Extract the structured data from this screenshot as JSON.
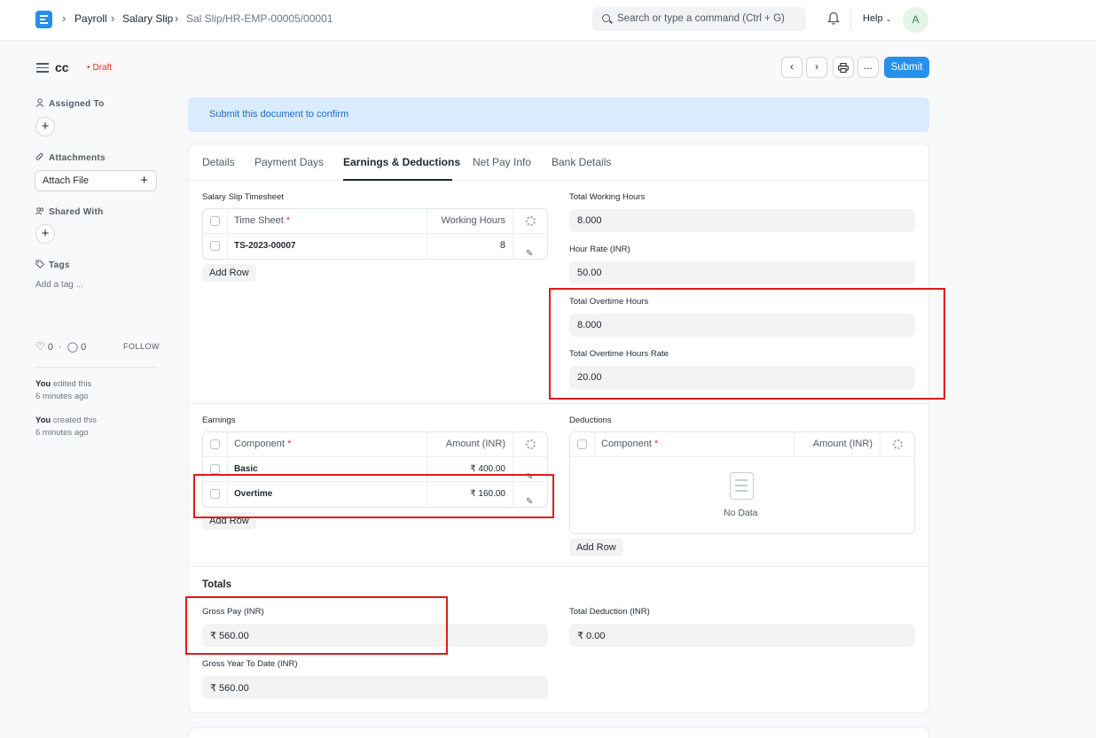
{
  "navbar": {
    "breadcrumbs": [
      "Payroll",
      "Salary Slip",
      "Sal Slip/HR-EMP-00005/00001"
    ],
    "search_placeholder": "Search or type a command (Ctrl + G)",
    "help_label": "Help",
    "avatar_initial": "A"
  },
  "page": {
    "title": "cc",
    "status": "Draft",
    "submit_label": "Submit",
    "more_label": "..."
  },
  "sidebar": {
    "assigned_to": "Assigned To",
    "attachments": "Attachments",
    "attach_file": "Attach File",
    "shared_with": "Shared With",
    "tags": "Tags",
    "add_tag": "Add a tag ...",
    "likes": "0",
    "comments": "0",
    "follow": "FOLLOW",
    "activity": [
      {
        "who": "You",
        "action": " edited this",
        "when": "6 minutes ago"
      },
      {
        "who": "You",
        "action": " created this",
        "when": "6 minutes ago"
      }
    ]
  },
  "banner": "Submit this document to confirm",
  "tabs": [
    "Details",
    "Payment Days",
    "Earnings & Deductions",
    "Net Pay Info",
    "Bank Details"
  ],
  "active_tab": "Earnings & Deductions",
  "timesheet": {
    "label": "Salary Slip Timesheet",
    "columns": [
      "Time Sheet",
      "Working Hours"
    ],
    "rows": [
      {
        "time_sheet": "TS-2023-00007",
        "hours": "8"
      }
    ],
    "add_row": "Add Row"
  },
  "fields": {
    "total_working_hours": {
      "label": "Total Working Hours",
      "value": "8.000"
    },
    "hour_rate": {
      "label": "Hour Rate (INR)",
      "value": "50.00"
    },
    "total_overtime_hours": {
      "label": "Total Overtime Hours",
      "value": "8.000"
    },
    "total_overtime_hours_rate": {
      "label": "Total Overtime Hours Rate",
      "value": "20.00"
    }
  },
  "earnings": {
    "label": "Earnings",
    "columns": [
      "Component",
      "Amount (INR)"
    ],
    "rows": [
      {
        "component": "Basic",
        "amount": "₹ 400.00"
      },
      {
        "component": "Overtime",
        "amount": "₹ 160.00"
      }
    ],
    "add_row": "Add Row"
  },
  "deductions": {
    "label": "Deductions",
    "columns": [
      "Component",
      "Amount (INR)"
    ],
    "empty": "No Data",
    "add_row": "Add Row"
  },
  "totals": {
    "heading": "Totals",
    "gross_pay": {
      "label": "Gross Pay (INR)",
      "value": "₹ 560.00"
    },
    "total_deduction": {
      "label": "Total Deduction (INR)",
      "value": "₹ 0.00"
    },
    "gross_ytd": {
      "label": "Gross Year To Date (INR)",
      "value": "₹ 560.00"
    }
  },
  "colors": {
    "primary": "#2490ef",
    "highlight_box": "#e01b1b",
    "draft": "#e03636"
  }
}
